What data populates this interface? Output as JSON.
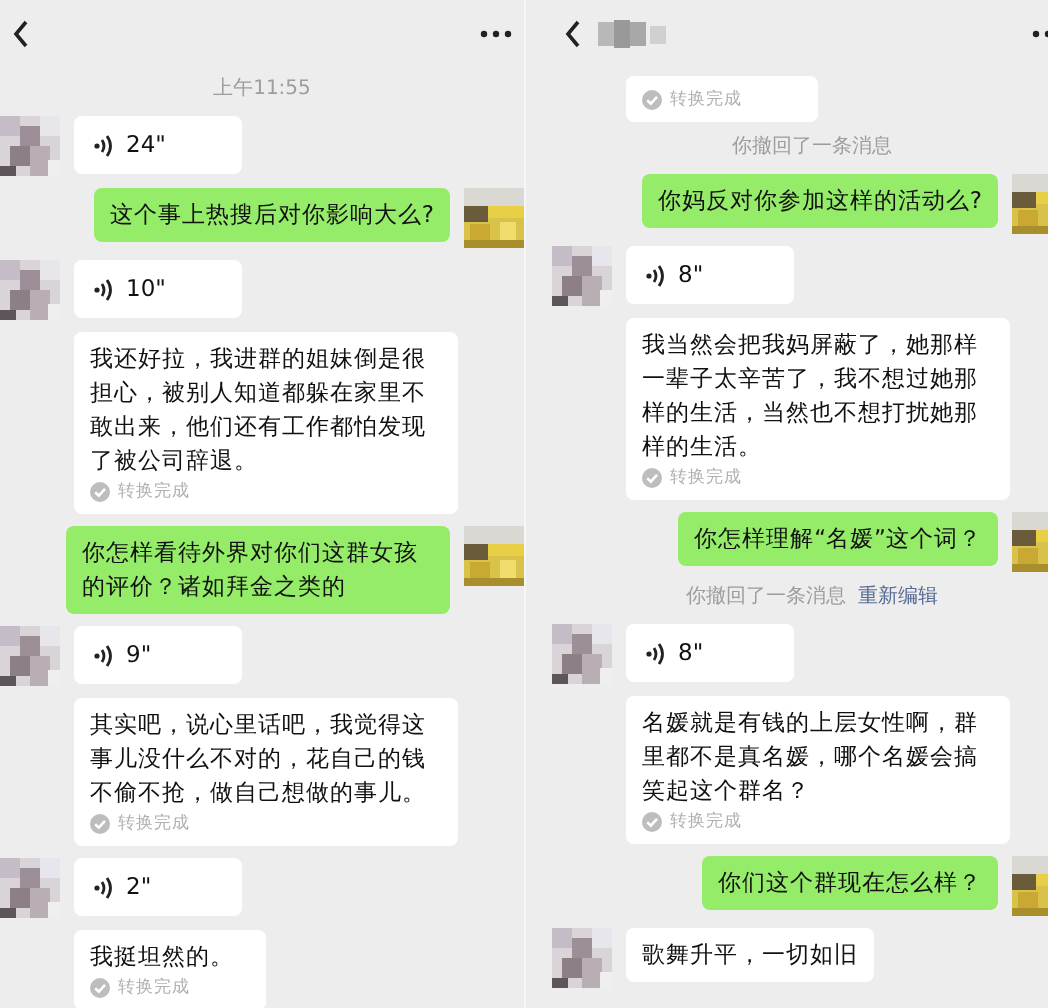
{
  "panels": [
    {
      "messages": [
        {
          "kind": "time",
          "text": "上午11:55"
        },
        {
          "kind": "voice",
          "outgoing": false,
          "duration": "24\""
        },
        {
          "kind": "text",
          "outgoing": true,
          "text": "这个事上热搜后对你影响大么?"
        },
        {
          "kind": "voice",
          "outgoing": false,
          "duration": "10\""
        },
        {
          "kind": "transcript",
          "text": "我还好拉，我进群的姐妹倒是很担心，被别人知道都躲在家里不敢出来，他们还有工作都怕发现了被公司辞退。",
          "note": "转换完成"
        },
        {
          "kind": "text",
          "outgoing": true,
          "text": "你怎样看待外界对你们这群女孩的评价？诸如拜金之类的"
        },
        {
          "kind": "voice",
          "outgoing": false,
          "duration": "9\""
        },
        {
          "kind": "transcript",
          "text": "其实吧，说心里话吧，我觉得这事儿没什么不对的，花自己的钱不偷不抢，做自己想做的事儿。",
          "note": "转换完成"
        },
        {
          "kind": "voice",
          "outgoing": false,
          "duration": "2\""
        },
        {
          "kind": "transcript",
          "text": "我挺坦然的。",
          "note": "转换完成"
        }
      ]
    },
    {
      "messages": [
        {
          "kind": "transcript",
          "note": "转换完成"
        },
        {
          "kind": "recall",
          "text": "你撤回了一条消息"
        },
        {
          "kind": "text",
          "outgoing": true,
          "text": "你妈反对你参加这样的活动么?"
        },
        {
          "kind": "voice",
          "outgoing": false,
          "duration": "8\""
        },
        {
          "kind": "transcript",
          "text": "我当然会把我妈屏蔽了，她那样一辈子太辛苦了，我不想过她那样的生活，当然也不想打扰她那样的生活。",
          "note": "转换完成"
        },
        {
          "kind": "text",
          "outgoing": true,
          "text": "你怎样理解“名媛”这个词？"
        },
        {
          "kind": "recall",
          "text": "你撤回了一条消息",
          "link": "重新编辑"
        },
        {
          "kind": "voice",
          "outgoing": false,
          "duration": "8\""
        },
        {
          "kind": "transcript",
          "text": "名媛就是有钱的上层女性啊，群里都不是真名媛，哪个名媛会搞笑起这个群名？",
          "note": "转换完成"
        },
        {
          "kind": "text",
          "outgoing": true,
          "text": "你们这个群现在怎么样？"
        },
        {
          "kind": "text",
          "outgoing": false,
          "text": "歌舞升平，一切如旧"
        }
      ]
    }
  ]
}
